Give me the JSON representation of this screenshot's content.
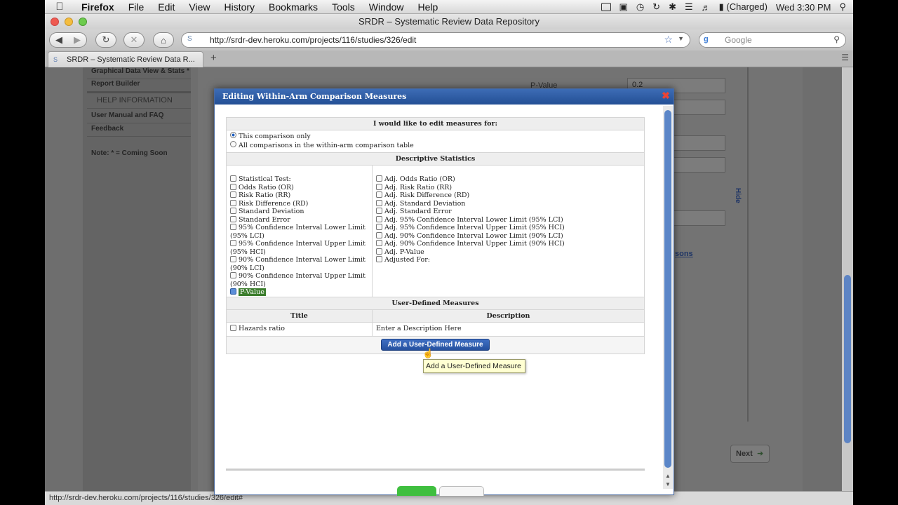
{
  "menubar": {
    "app": "Firefox",
    "items": [
      "File",
      "Edit",
      "View",
      "History",
      "Bookmarks",
      "Tools",
      "Window",
      "Help"
    ],
    "battery": "(Charged)",
    "clock": "Wed 3:30 PM"
  },
  "window": {
    "title": "SRDR – Systematic Review Data Repository"
  },
  "browser": {
    "url": "http://srdr-dev.heroku.com/projects/116/studies/326/edit",
    "search_placeholder": "Google",
    "tab_title": "SRDR – Systematic Review Data R...",
    "status_url": "http://srdr-dev.heroku.com/projects/116/studies/326/edit#"
  },
  "background_page": {
    "sidebar": {
      "items_top": [
        "Graphical Data View & Stats *",
        "Report Builder"
      ],
      "help_header": "HELP INFORMATION",
      "help_items": [
        "User Manual and FAQ",
        "Feedback"
      ],
      "note": "Note: * = Coming Soon"
    },
    "pvalue_label": "P-Value",
    "pvalue_value": "0.2",
    "hide_link": "Hide",
    "sons_link": "sons",
    "next_button": "Next"
  },
  "dialog": {
    "title": "Editing Within-Arm Comparison Measures",
    "scope_header": "I would like to edit measures for:",
    "scope_options": [
      {
        "label": "This comparison only",
        "selected": true
      },
      {
        "label": "All comparisons in the within-arm comparison table",
        "selected": false
      }
    ],
    "descriptive_header": "Descriptive Statistics",
    "left_measures": [
      {
        "label": "Statistical Test:",
        "checked": false
      },
      {
        "label": "Odds Ratio (OR)",
        "checked": false
      },
      {
        "label": "Risk Ratio (RR)",
        "checked": false
      },
      {
        "label": "Risk Difference (RD)",
        "checked": false
      },
      {
        "label": "Standard Deviation",
        "checked": false
      },
      {
        "label": "Standard Error",
        "checked": false
      },
      {
        "label": "95% Confidence Interval Lower Limit (95% LCI)",
        "checked": false
      },
      {
        "label": "95% Confidence Interval Upper Limit (95% HCI)",
        "checked": false
      },
      {
        "label": "90% Confidence Interval Lower Limit (90% LCI)",
        "checked": false
      },
      {
        "label": "90% Confidence Interval Upper Limit (90% HCI)",
        "checked": false
      },
      {
        "label": "P-Value",
        "checked": true
      }
    ],
    "right_measures": [
      {
        "label": "Adj. Odds Ratio (OR)",
        "checked": false
      },
      {
        "label": "Adj. Risk Ratio (RR)",
        "checked": false
      },
      {
        "label": "Adj. Risk Difference (RD)",
        "checked": false
      },
      {
        "label": "Adj. Standard Deviation",
        "checked": false
      },
      {
        "label": "Adj. Standard Error",
        "checked": false
      },
      {
        "label": "Adj. 95% Confidence Interval Lower Limit (95% LCI)",
        "checked": false
      },
      {
        "label": "Adj. 95% Confidence Interval Upper Limit (95% HCI)",
        "checked": false
      },
      {
        "label": "Adj. 90% Confidence Interval Lower Limit (90% LCI)",
        "checked": false
      },
      {
        "label": "Adj. 90% Confidence Interval Upper Limit (90% HCI)",
        "checked": false
      },
      {
        "label": "Adj. P-Value",
        "checked": false
      },
      {
        "label": "Adjusted For:",
        "checked": false
      }
    ],
    "user_defined_header": "User-Defined Measures",
    "col_title": "Title",
    "col_description": "Description",
    "user_measures": [
      {
        "title": "Hazards ratio",
        "description": "Enter a Description Here",
        "checked": false
      }
    ],
    "add_button": "Add a User-Defined Measure",
    "tooltip": "Add a User-Defined Measure"
  }
}
